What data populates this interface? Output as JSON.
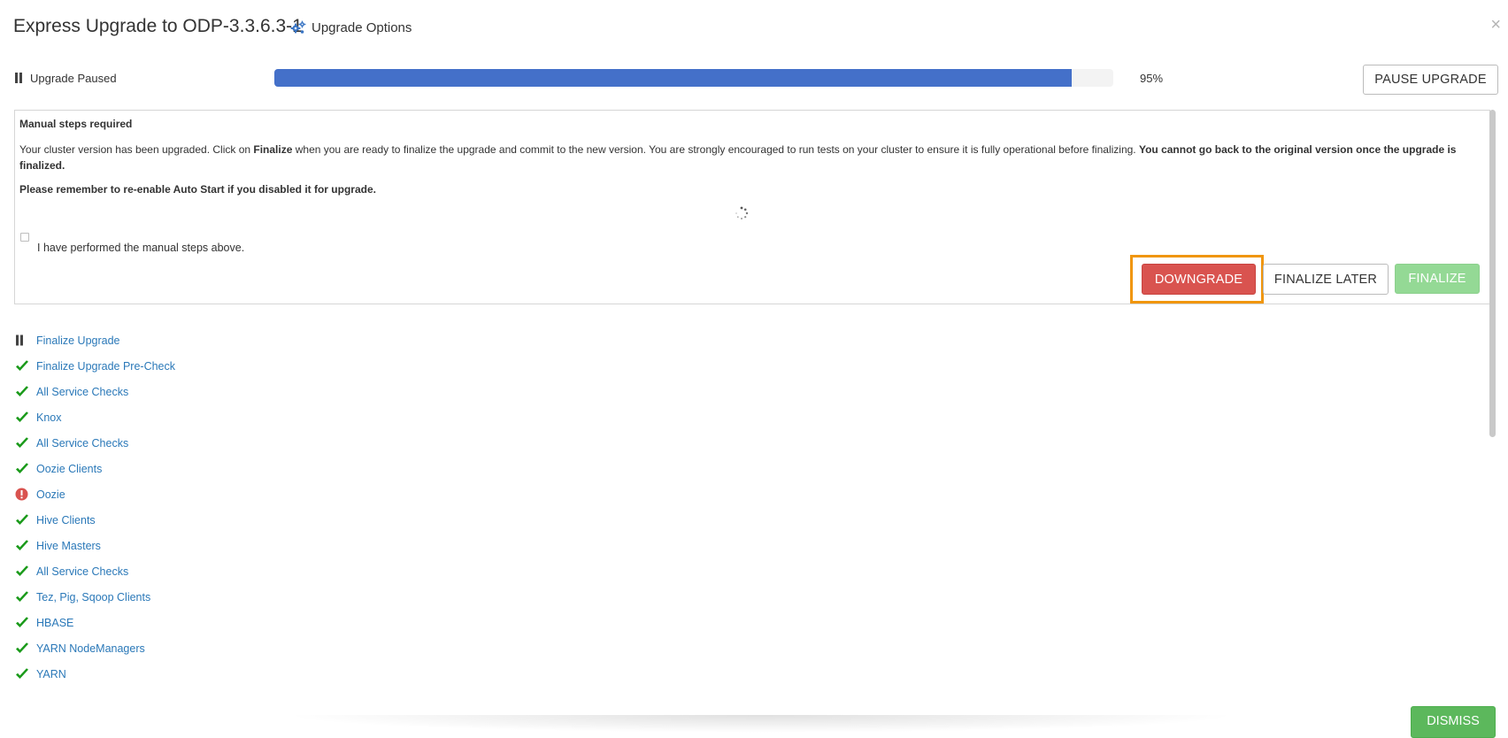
{
  "header": {
    "title": "Express Upgrade to ODP-3.3.6.3-1",
    "options_label": "Upgrade Options",
    "close_symbol": "×"
  },
  "status": {
    "label": "Upgrade Paused",
    "progress_percent": 95,
    "progress_text": "95%",
    "pause_button": "PAUSE UPGRADE"
  },
  "manual_steps": {
    "title": "Manual steps required",
    "text_1": "Your cluster version has been upgraded. Click on ",
    "text_bold_1": "Finalize",
    "text_2": " when you are ready to finalize the upgrade and commit to the new version. You are strongly encouraged to run tests on your cluster to ensure it is fully operational before finalizing. ",
    "text_bold_2": "You cannot go back to the original version once the upgrade is finalized.",
    "reminder": "Please remember to re-enable Auto Start if you disabled it for upgrade.",
    "checkbox_label": "I have performed the manual steps above.",
    "checkbox_checked": false,
    "buttons": {
      "downgrade": "DOWNGRADE",
      "finalize_later": "FINALIZE LATER",
      "finalize": "FINALIZE"
    }
  },
  "tasks": [
    {
      "label": "Finalize Upgrade",
      "status": "paused",
      "icon": "pause-icon"
    },
    {
      "label": "Finalize Upgrade Pre-Check",
      "status": "completed",
      "icon": "check-icon"
    },
    {
      "label": "All Service Checks",
      "status": "completed",
      "icon": "check-icon"
    },
    {
      "label": "Knox",
      "status": "completed",
      "icon": "check-icon"
    },
    {
      "label": "All Service Checks",
      "status": "completed",
      "icon": "check-icon"
    },
    {
      "label": "Oozie Clients",
      "status": "completed",
      "icon": "check-icon"
    },
    {
      "label": "Oozie",
      "status": "failed",
      "icon": "error-icon"
    },
    {
      "label": "Hive Clients",
      "status": "completed",
      "icon": "check-icon"
    },
    {
      "label": "Hive Masters",
      "status": "completed",
      "icon": "check-icon"
    },
    {
      "label": "All Service Checks",
      "status": "completed",
      "icon": "check-icon"
    },
    {
      "label": "Tez, Pig, Sqoop Clients",
      "status": "completed",
      "icon": "check-icon"
    },
    {
      "label": "HBASE",
      "status": "completed",
      "icon": "check-icon"
    },
    {
      "label": "YARN NodeManagers",
      "status": "completed",
      "icon": "check-icon"
    },
    {
      "label": "YARN",
      "status": "completed",
      "icon": "check-icon"
    }
  ],
  "footer": {
    "dismiss": "DISMISS"
  },
  "colors": {
    "progress": "#4470c9",
    "downgrade": "#d9534f",
    "finalize": "#94d995",
    "dismiss": "#5cb85c",
    "link": "#2a78b8",
    "success": "#1a9a1a",
    "error": "#d9534f",
    "highlight": "#f0960e"
  }
}
